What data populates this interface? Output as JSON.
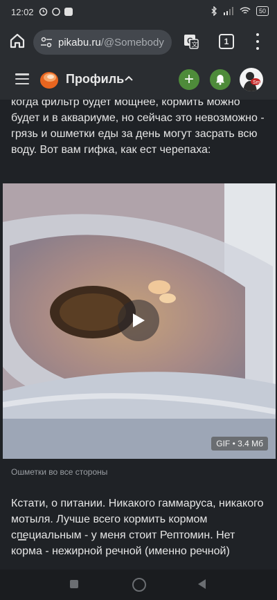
{
  "status": {
    "time": "12:02",
    "battery": "50"
  },
  "browser": {
    "url_domain": "pikabu.ru",
    "url_path": "/@Somebody",
    "tab_count": "1"
  },
  "header": {
    "title": "Профиль"
  },
  "post": {
    "paragraph1": "когда фильтр будет мощнее, кормить можно будет и в аквариуме, но сейчас это невозможно - грязь и ошметки еды за день могут засрать всю воду. Вот вам гифка, как ест черепаха:",
    "gif_badge": "GIF • 3.4 Мб",
    "gif_caption": "Ошметки во все стороны",
    "paragraph2": "Кстати, о питании. Никакого гаммаруса, никакого мотыля. Лучше всего кормить кормом специальным - у меня стоит Рептомин. Нет корма - нежирной речной (именно речной)"
  },
  "colors": {
    "accent_green": "#4e8b3a",
    "background": "#1f2226",
    "header": "#2a2d31"
  },
  "icons": [
    "home-icon",
    "tune-icon",
    "translate-icon",
    "menu-dots-icon",
    "hamburger-icon",
    "pikabu-logo-icon",
    "chevron-up-icon",
    "plus-icon",
    "bell-icon",
    "play-icon"
  ]
}
